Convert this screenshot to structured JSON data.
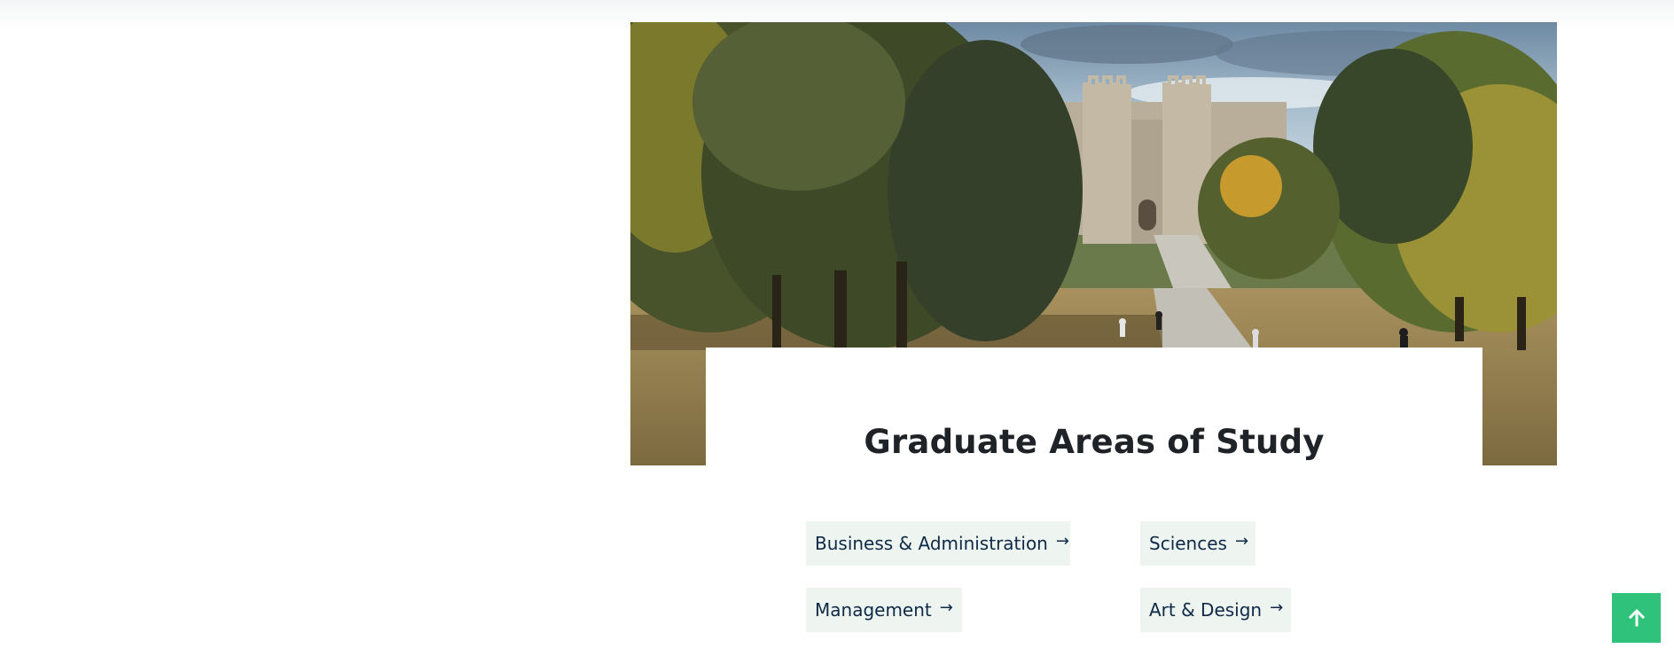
{
  "page": {
    "background": "#ffffff"
  },
  "hero": {
    "image_alt": "Castle at the end of a tree-lined park avenue with people walking",
    "icon": "hero-photo"
  },
  "section": {
    "title": "Graduate Areas of Study"
  },
  "areas": [
    {
      "label": "Business & Administration",
      "icon": "arrow-right-icon"
    },
    {
      "label": "Sciences",
      "icon": "arrow-right-icon"
    },
    {
      "label": "Management",
      "icon": "arrow-right-icon"
    },
    {
      "label": "Art & Design",
      "icon": "arrow-right-icon"
    }
  ],
  "colors": {
    "title": "#1f2328",
    "link_text": "#0e2a47",
    "link_bg": "#eef4ef",
    "scroll_button": "#2fc27a"
  },
  "scroll_top": {
    "icon": "arrow-up-icon"
  }
}
